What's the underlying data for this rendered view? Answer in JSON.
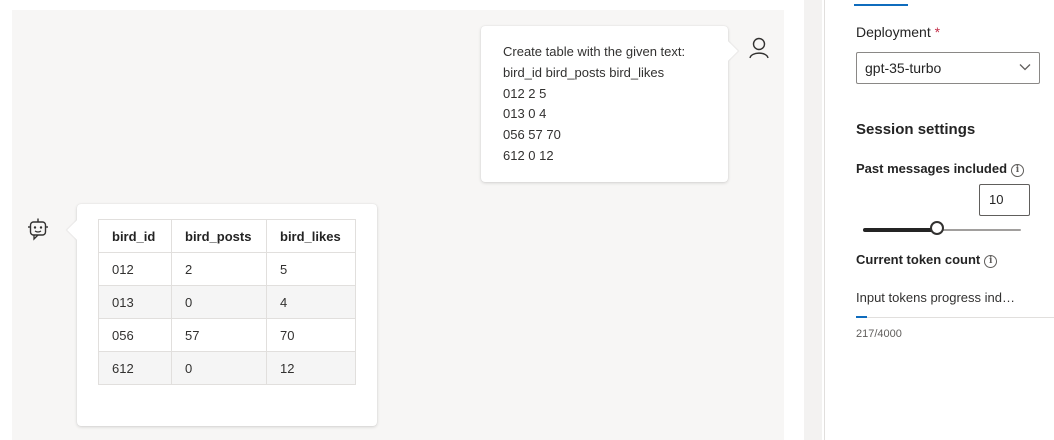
{
  "chat": {
    "user_message": {
      "lines": [
        "Create table with the given text:",
        "bird_id bird_posts bird_likes",
        "012 2 5",
        "013 0 4",
        "056 57 70",
        "612 0 12"
      ]
    },
    "assistant_table": {
      "headers": [
        "bird_id",
        "bird_posts",
        "bird_likes"
      ],
      "rows": [
        [
          "012",
          "2",
          "5"
        ],
        [
          "013",
          "0",
          "4"
        ],
        [
          "056",
          "57",
          "70"
        ],
        [
          "612",
          "0",
          "12"
        ]
      ]
    },
    "icons": {
      "user": "person-icon",
      "assistant": "bot-icon"
    }
  },
  "panel": {
    "deployment_label": "Deployment",
    "required_mark": "*",
    "deployment_value": "gpt-35-turbo",
    "session_title": "Session settings",
    "past_messages_label": "Past messages included",
    "past_messages_value": "10",
    "slider_fraction": 0.47,
    "token_count_label": "Current token count",
    "token_progress_text": "Input tokens progress indicator",
    "token_progress_count": "217/4000",
    "token_progress_fraction": 0.054,
    "accent_color": "#0f6cbd"
  }
}
